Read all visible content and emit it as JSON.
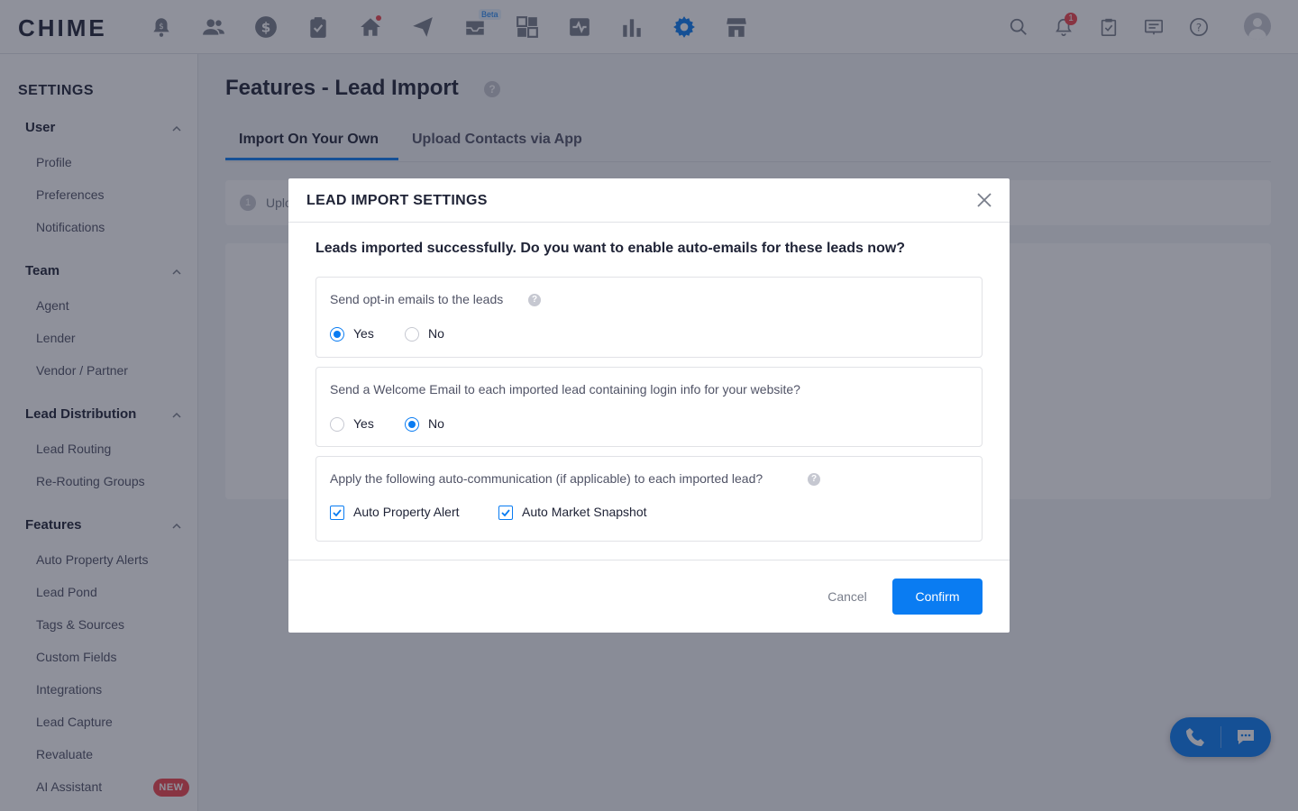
{
  "app": {
    "logo": "CHIME"
  },
  "topnav": {
    "icons": [
      "alert-dollar-icon",
      "people-icon",
      "dollar-icon",
      "clipboard-icon",
      "home-icon",
      "send-icon",
      "inbox-icon",
      "dashboard-icon",
      "activity-icon",
      "bar-chart-icon",
      "gear-icon",
      "store-icon"
    ],
    "beta_label": "Beta",
    "notification_count": "1",
    "right_icons": [
      "search-icon",
      "bell-icon",
      "task-icon",
      "presentation-icon",
      "help-icon"
    ]
  },
  "sidebar": {
    "title": "SETTINGS",
    "groups": [
      {
        "label": "User",
        "items": [
          "Profile",
          "Preferences",
          "Notifications"
        ]
      },
      {
        "label": "Team",
        "items": [
          "Agent",
          "Lender",
          "Vendor / Partner"
        ]
      },
      {
        "label": "Lead Distribution",
        "items": [
          "Lead Routing",
          "Re-Routing Groups"
        ]
      },
      {
        "label": "Features",
        "items": [
          "Auto Property Alerts",
          "Lead Pond",
          "Tags & Sources",
          "Custom Fields",
          "Integrations",
          "Lead Capture",
          "Revaluate",
          "AI Assistant"
        ]
      }
    ],
    "new_badge": "NEW"
  },
  "main": {
    "title": "Features - Lead Import",
    "tabs": [
      "Import On Your Own",
      "Upload Contacts via App"
    ],
    "step_number": "1",
    "step_text": "Uplo"
  },
  "modal": {
    "title": "LEAD IMPORT SETTINGS",
    "question": "Leads imported successfully. Do you want to enable auto-emails for these leads now?",
    "sections": [
      {
        "label": "Send opt-in emails to the leads",
        "options": [
          "Yes",
          "No"
        ],
        "selected": "Yes"
      },
      {
        "label": "Send a Welcome Email to each imported lead containing login info for your website?",
        "options": [
          "Yes",
          "No"
        ],
        "selected": "No"
      },
      {
        "label": "Apply the following auto-communication (if applicable) to each imported lead?",
        "checkboxes": [
          "Auto Property Alert",
          "Auto Market Snapshot"
        ]
      }
    ],
    "cancel_label": "Cancel",
    "confirm_label": "Confirm"
  },
  "colors": {
    "accent": "#0a7cf2",
    "danger": "#f0454c",
    "text": "#202437",
    "muted": "#797e8b"
  }
}
